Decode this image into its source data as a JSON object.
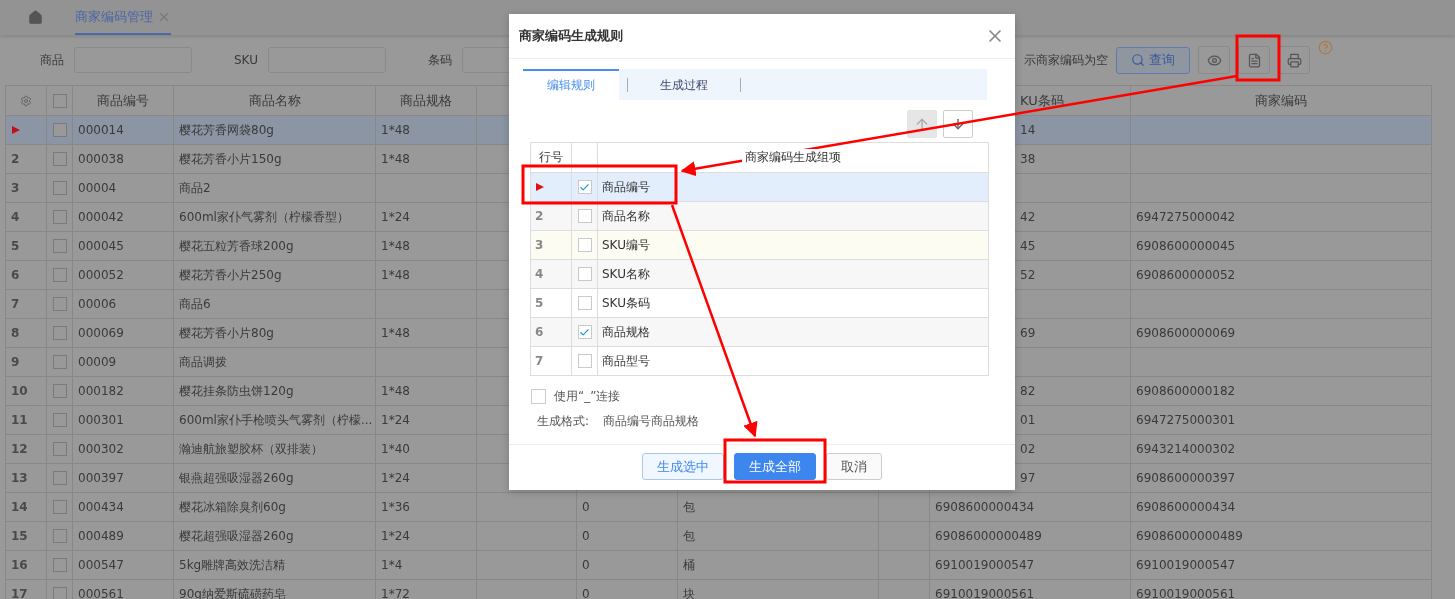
{
  "tab_bar": {
    "tabs": [
      {
        "label": "商家编码管理",
        "selected": true
      }
    ]
  },
  "filter_bar": {
    "fields": [
      {
        "label": "商品"
      },
      {
        "label": "SKU"
      },
      {
        "label": "条码"
      }
    ],
    "empty_code_option": "示商家编码为空",
    "query_button": "查询"
  },
  "table": {
    "select_all_checked": false,
    "columns": [
      "商品编号",
      "商品名称",
      "商品规格",
      "KU条码",
      "商家编码"
    ],
    "rows": [
      {
        "checked": false,
        "selected": true,
        "code": "000014",
        "name": "樱花芳香网袋80g",
        "spec": "1*48",
        "sku_barcode": "14",
        "merchant_code": ""
      },
      {
        "number": "2",
        "checked": false,
        "selected": false,
        "code": "000038",
        "name": "樱花芳香小片150g",
        "spec": "1*48",
        "sku_barcode": "38",
        "merchant_code": ""
      },
      {
        "number": "3",
        "checked": false,
        "selected": false,
        "code": "00004",
        "name": "商品2",
        "spec": "",
        "sku_barcode": "",
        "merchant_code": ""
      },
      {
        "number": "4",
        "checked": false,
        "selected": false,
        "code": "000042",
        "name": "600ml家仆气雾剂（柠檬香型）",
        "spec": "1*24",
        "sku_barcode": "42",
        "merchant_code": "6947275000042"
      },
      {
        "number": "5",
        "checked": false,
        "selected": false,
        "code": "000045",
        "name": "樱花五粒芳香球200g",
        "spec": "1*48",
        "sku_barcode": "45",
        "merchant_code": "6908600000045"
      },
      {
        "number": "6",
        "checked": false,
        "selected": false,
        "code": "000052",
        "name": "樱花芳香小片250g",
        "spec": "1*48",
        "sku_barcode": "52",
        "merchant_code": "6908600000052"
      },
      {
        "number": "7",
        "checked": false,
        "selected": false,
        "code": "00006",
        "name": "商品6",
        "spec": "",
        "sku_barcode": "",
        "merchant_code": ""
      },
      {
        "number": "8",
        "checked": false,
        "selected": false,
        "code": "000069",
        "name": "樱花芳香小片80g",
        "spec": "1*48",
        "sku_barcode": "69",
        "merchant_code": "6908600000069"
      },
      {
        "number": "9",
        "checked": false,
        "selected": false,
        "code": "00009",
        "name": "商品调拨",
        "spec": "",
        "sku_barcode": "",
        "merchant_code": ""
      },
      {
        "number": "10",
        "checked": false,
        "selected": false,
        "code": "000182",
        "name": "樱花挂条防虫饼120g",
        "spec": "1*48",
        "sku_barcode": "82",
        "merchant_code": "6908600000182"
      },
      {
        "number": "11",
        "checked": false,
        "selected": false,
        "code": "000301",
        "name": "600ml家仆手枪喷头气雾剂（柠檬...",
        "spec": "1*24",
        "sku_barcode": "01",
        "merchant_code": "6947275000301"
      },
      {
        "number": "12",
        "checked": false,
        "selected": false,
        "code": "000302",
        "name": "瀚迪航旅塑胶杯（双排装）",
        "spec": "1*40",
        "sku_barcode": "02",
        "merchant_code": "6943214000302"
      },
      {
        "number": "13",
        "checked": false,
        "selected": false,
        "code": "000397",
        "name": "银燕超强吸湿器260g",
        "spec": "1*24",
        "sku_barcode": "97",
        "merchant_code": "6908600000397"
      },
      {
        "number": "14",
        "checked": false,
        "selected": false,
        "code": "000434",
        "name": "樱花冰箱除臭剂60g",
        "spec": "1*36",
        "column_5": "0",
        "column_6": "包",
        "sku_barcode": "6908600000434",
        "merchant_code": "6908600000434"
      },
      {
        "number": "15",
        "checked": false,
        "selected": false,
        "code": "000489",
        "name": "樱花超强吸湿器260g",
        "spec": "1*24",
        "column_5": "0",
        "column_6": "包",
        "sku_barcode": "69086000000489",
        "merchant_code": "69086000000489"
      },
      {
        "number": "16",
        "checked": false,
        "selected": false,
        "code": "000547",
        "name": "5kg雕牌高效洗洁精",
        "spec": "1*4",
        "column_5": "0",
        "column_6": "桶",
        "sku_barcode": "6910019000547",
        "merchant_code": "6910019000547"
      },
      {
        "number": "17",
        "checked": false,
        "selected": false,
        "code": "000561",
        "name": "90g纳爱斯硫磺药皂",
        "spec": "1*72",
        "column_5": "0",
        "column_6": "块",
        "sku_barcode": "6910019000561",
        "merchant_code": "6910019000561"
      }
    ]
  },
  "dialog": {
    "title": "商家编码生成规则",
    "tabs": [
      {
        "label": "编辑规则",
        "selected": true
      },
      {
        "label": "生成过程",
        "selected": false
      }
    ],
    "move_buttons": [
      {
        "kind": "up",
        "disabled": true
      },
      {
        "kind": "down",
        "disabled": false
      }
    ],
    "columns": [
      "行号",
      "商家编码生成组项"
    ],
    "rows": [
      {
        "selected": true,
        "checked": true,
        "item": "商品编号"
      },
      {
        "number": "2",
        "selected": false,
        "checked": false,
        "item": "商品名称"
      },
      {
        "number": "3",
        "selected": false,
        "checked": false,
        "item": "SKU编号"
      },
      {
        "number": "4",
        "selected": false,
        "checked": false,
        "item": "SKU名称"
      },
      {
        "number": "5",
        "selected": false,
        "checked": false,
        "item": "SKU条码"
      },
      {
        "number": "6",
        "selected": false,
        "checked": true,
        "item": "商品规格"
      },
      {
        "number": "7",
        "selected": false,
        "checked": false,
        "item": "商品型号"
      }
    ],
    "underscore_option": {
      "label": "使用“_”连接",
      "checked": false
    },
    "format": {
      "label": "生成格式:",
      "value": "商品编号商品规格"
    },
    "buttons": [
      {
        "kind": "secondary",
        "label": "生成选中"
      },
      {
        "kind": "primary",
        "label": "生成全部"
      },
      {
        "kind": "default",
        "label": "取消"
      }
    ]
  }
}
